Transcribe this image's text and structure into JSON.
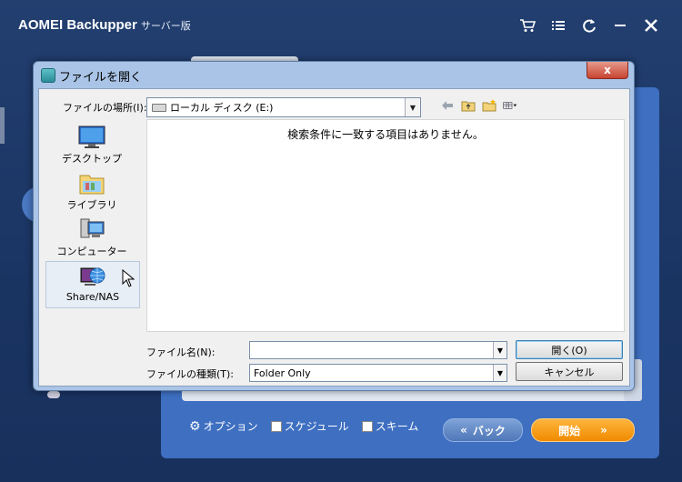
{
  "app": {
    "title": "AOMEI Backupper",
    "edition": "サーバー版",
    "bottom": {
      "options_label": "オプション",
      "schedule_label": "スケジュール",
      "scheme_label": "スキーム",
      "back_label": "バック",
      "start_label": "開始"
    }
  },
  "dialog": {
    "title": "ファイルを開く",
    "close_symbol": "x",
    "lookin_label": "ファイルの場所(I):",
    "lookin_value": "ローカル ディスク (E:)",
    "places": [
      {
        "label": "デスクトップ"
      },
      {
        "label": "ライブラリ"
      },
      {
        "label": "コンピューター"
      },
      {
        "label": "Share/NAS"
      }
    ],
    "empty_message": "検索条件に一致する項目はありません。",
    "filename_label": "ファイル名(N):",
    "filename_value": "",
    "filetype_label": "ファイルの種類(T):",
    "filetype_value": "Folder Only",
    "open_button": "開く(O)",
    "cancel_button": "キャンセル"
  },
  "colors": {
    "app_bg": "#1b3a66",
    "panel_blue": "#3e6fc1",
    "start_orange": "#f08a00",
    "dialog_frame": "#a9c4e6"
  }
}
